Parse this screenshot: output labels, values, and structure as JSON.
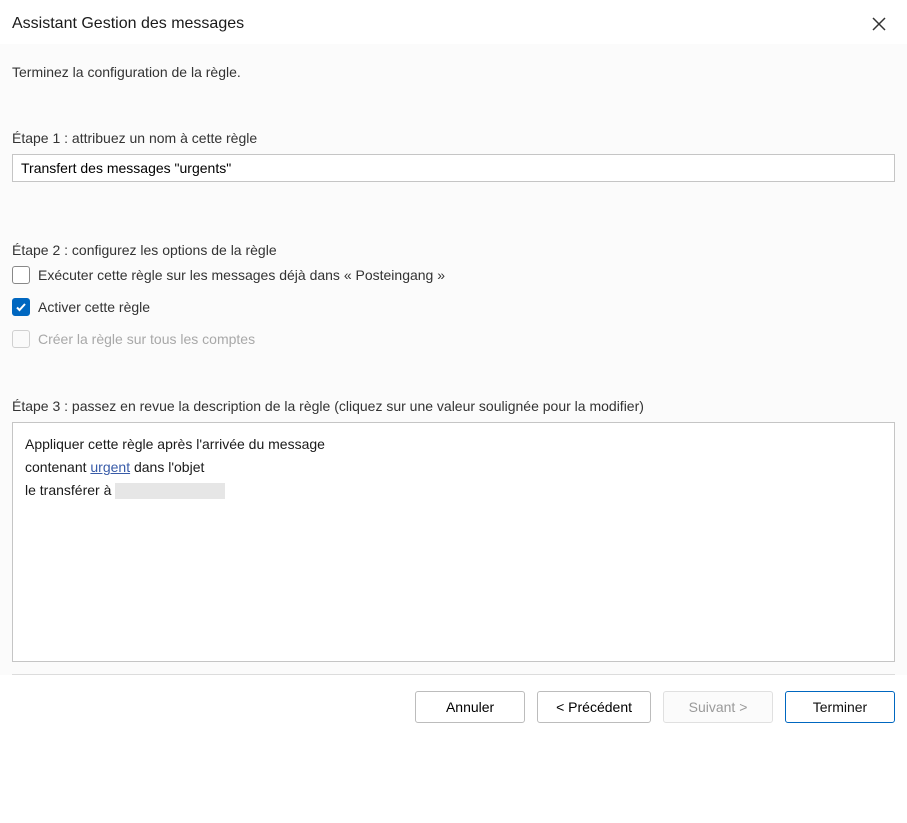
{
  "titlebar": {
    "title": "Assistant Gestion des messages"
  },
  "instruction": "Terminez la configuration de la règle.",
  "step1": {
    "label": "Étape 1 : attribuez un nom à cette règle",
    "value": "Transfert des messages \"urgents\""
  },
  "step2": {
    "label": "Étape 2 : configurez les options de la règle",
    "options": [
      {
        "label": "Exécuter cette règle sur les messages déjà dans « Posteingang »",
        "checked": false,
        "disabled": false
      },
      {
        "label": "Activer cette règle",
        "checked": true,
        "disabled": false
      },
      {
        "label": "Créer la règle sur tous les comptes",
        "checked": false,
        "disabled": true
      }
    ]
  },
  "step3": {
    "label": "Étape 3 : passez en revue la description de la règle (cliquez sur une valeur soulignée pour la modifier)",
    "line1": "Appliquer cette règle après l'arrivée du message",
    "line2_prefix": "contenant ",
    "line2_link": "urgent",
    "line2_suffix": " dans l'objet",
    "line3_prefix": "le transférer à "
  },
  "buttons": {
    "cancel": "Annuler",
    "back": "< Précédent",
    "next": "Suivant >",
    "finish": "Terminer"
  },
  "colors": {
    "accent": "#0067c0",
    "link": "#385ba8"
  }
}
